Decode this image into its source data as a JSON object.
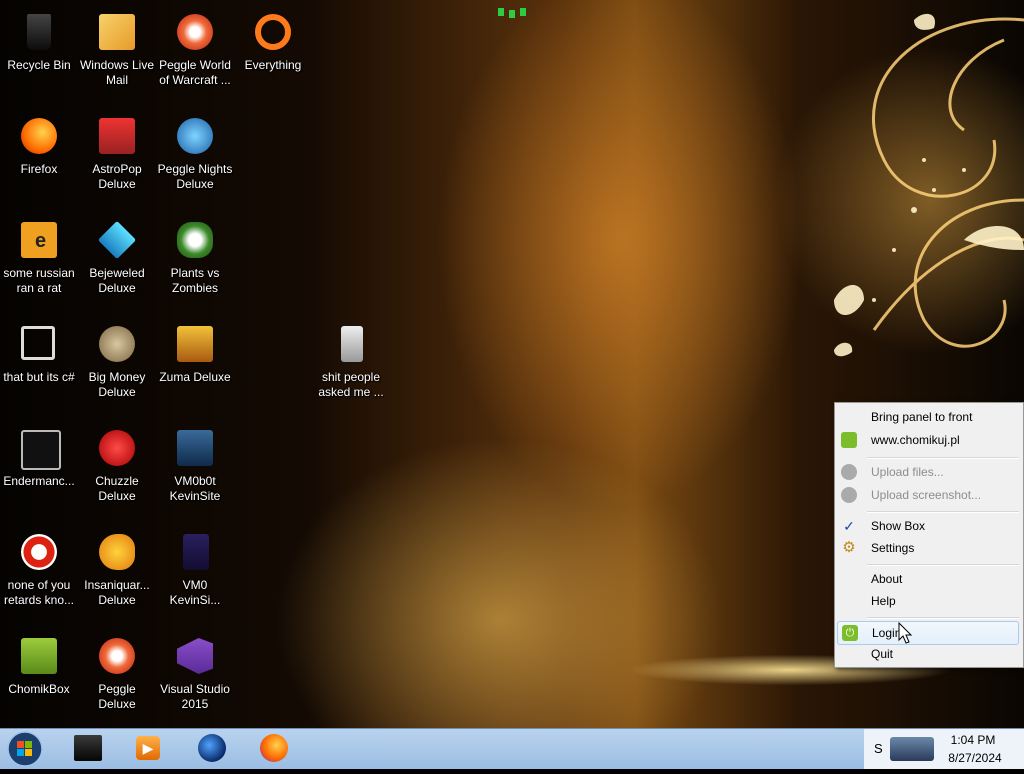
{
  "desktop": {
    "icons": [
      {
        "name": "recycle-bin",
        "label": "Recycle Bin",
        "icon": "recycle-bin-icon"
      },
      {
        "name": "windows-live-mail",
        "label": "Windows Live Mail",
        "icon": "mail-icon"
      },
      {
        "name": "peggle-world-of-warcraft",
        "label": "Peggle World of Warcraft ...",
        "icon": "peggle-icon"
      },
      {
        "name": "everything",
        "label": "Everything",
        "icon": "search-app-icon"
      },
      {
        "name": "firefox",
        "label": "Firefox",
        "icon": "firefox-icon"
      },
      {
        "name": "astropop-deluxe",
        "label": "AstroPop Deluxe",
        "icon": "astropop-icon"
      },
      {
        "name": "peggle-nights-deluxe",
        "label": "Peggle Nights Deluxe",
        "icon": "peggle-nights-icon"
      },
      {
        "name": "some-russian-ran-a-rat",
        "label": "some russian ran a rat",
        "icon": "folder-e-icon"
      },
      {
        "name": "bejeweled-deluxe",
        "label": "Bejeweled Deluxe",
        "icon": "bejeweled-icon"
      },
      {
        "name": "plants-vs-zombies",
        "label": "Plants vs Zombies",
        "icon": "plants-icon"
      },
      {
        "name": "that-but-its-csharp",
        "label": "that but its c#",
        "icon": "shortcut-icon"
      },
      {
        "name": "big-money-deluxe",
        "label": "Big Money Deluxe",
        "icon": "big-money-icon"
      },
      {
        "name": "zuma-deluxe",
        "label": "Zuma Deluxe",
        "icon": "zuma-icon"
      },
      {
        "name": "shit-people-asked-me",
        "label": "shit people asked me ...",
        "icon": "folder-icon"
      },
      {
        "name": "endermanch",
        "label": "Endermanc...",
        "icon": "console-icon"
      },
      {
        "name": "chuzzle-deluxe",
        "label": "Chuzzle Deluxe",
        "icon": "chuzzle-icon"
      },
      {
        "name": "vm0b0t-kevinsite",
        "label": "VM0b0t KevinSite",
        "icon": "vm-icon"
      },
      {
        "name": "none-of-you-retards",
        "label": "none of you retards kno...",
        "icon": "red-circle-icon"
      },
      {
        "name": "insaniquarium-deluxe",
        "label": "Insaniquar... Deluxe",
        "icon": "fish-icon"
      },
      {
        "name": "vm0-kevinsi",
        "label": "VM0 KevinSi...",
        "icon": "file-icon"
      },
      {
        "name": "chomikbox",
        "label": "ChomikBox",
        "icon": "chomikbox-icon"
      },
      {
        "name": "peggle-deluxe",
        "label": "Peggle Deluxe",
        "icon": "peggle-deluxe-icon"
      },
      {
        "name": "visual-studio-2015",
        "label": "Visual Studio 2015",
        "icon": "visual-studio-icon"
      }
    ]
  },
  "context_menu": {
    "items": [
      {
        "label": "Bring panel to front",
        "enabled": true
      },
      {
        "label": "www.chomikuj.pl",
        "enabled": true,
        "icon": "home-icon"
      },
      {
        "label": "Upload files...",
        "enabled": false,
        "icon": "upload-icon"
      },
      {
        "label": "Upload screenshot...",
        "enabled": false,
        "icon": "upload-icon"
      },
      {
        "label": "Show Box",
        "enabled": true,
        "checked": true,
        "icon": "check-icon"
      },
      {
        "label": "Settings",
        "enabled": true,
        "icon": "gear-icon"
      },
      {
        "label": "About",
        "enabled": true
      },
      {
        "label": "Help",
        "enabled": true
      },
      {
        "label": "Login",
        "enabled": true,
        "highlighted": true,
        "icon": "power-icon"
      },
      {
        "label": "Quit",
        "enabled": true
      }
    ]
  },
  "taskbar": {
    "tray_letter": "S",
    "clock_time": "1:04 PM",
    "clock_date": "8/27/2024",
    "pinned": [
      "terminal-icon",
      "media-player-icon",
      "globe-icon",
      "firefox-icon"
    ]
  },
  "colors": {
    "taskbar": "#a9c8ea",
    "menu_bg": "#f0f0f0",
    "menu_highlight": "#e3effa",
    "disabled_text": "#8d8d8d"
  }
}
